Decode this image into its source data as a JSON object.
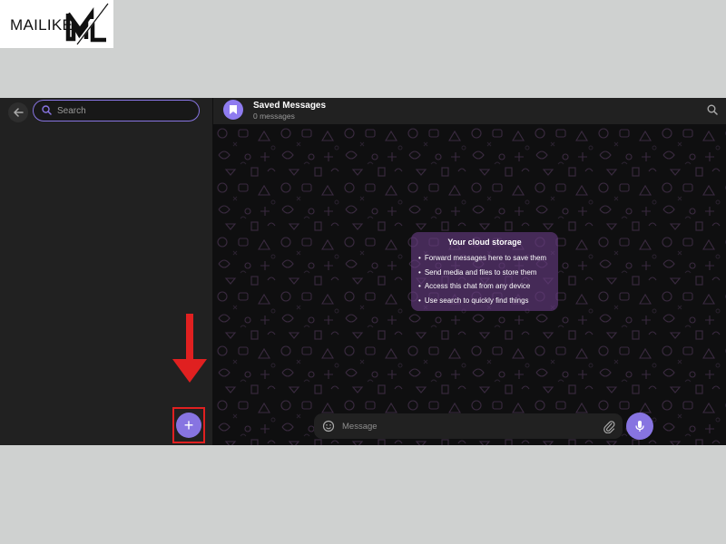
{
  "logo": {
    "text": "MAILIKE",
    "mark": "ML"
  },
  "colors": {
    "accent": "#8774e1",
    "highlight": "#e02020",
    "panel": "#212121",
    "chat_bg": "#0f0f10",
    "info_card": "#683c82"
  },
  "sidebar": {
    "back_icon": "arrow-left-icon",
    "search_placeholder": "Search",
    "new_chat_icon": "plus-icon",
    "new_chat_symbol": "+"
  },
  "chat": {
    "title": "Saved Messages",
    "subtitle": "0 messages",
    "avatar_icon": "bookmark-icon",
    "header_search_icon": "search-icon",
    "info": {
      "title": "Your cloud storage",
      "items": [
        "Forward messages here to save them",
        "Send media and files to store them",
        "Access this chat from any device",
        "Use search to quickly find things"
      ]
    },
    "composer": {
      "placeholder": "Message",
      "emoji_icon": "smile-icon",
      "attach_icon": "paperclip-icon",
      "mic_icon": "microphone-icon"
    }
  }
}
